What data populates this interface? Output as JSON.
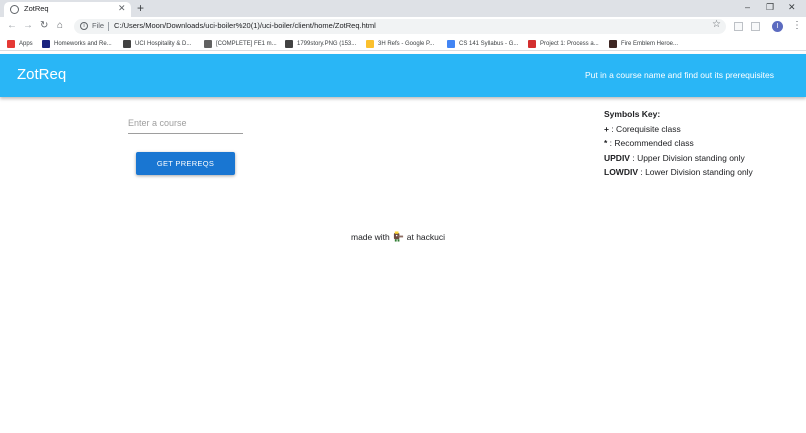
{
  "browser": {
    "tab_title": "ZotReq",
    "new_tab_symbol": "+",
    "file_label": "File",
    "url": "C:/Users/Moon/Downloads/uci-boiler%20(1)/uci-boiler/client/home/ZotReq.html",
    "profile_initial": "I"
  },
  "bookmarks": [
    {
      "label": "Apps",
      "icon_color": "#e53935"
    },
    {
      "label": "Homeworks and Re...",
      "icon_color": "#1a237e"
    },
    {
      "label": "UCI Hospitality & D...",
      "icon_color": "#424242"
    },
    {
      "label": "[COMPLETE] FE1 m...",
      "icon_color": "#616161"
    },
    {
      "label": "1799story.PNG (153...",
      "icon_color": "#424242"
    },
    {
      "label": "3H Refs - Google P...",
      "icon_color": "#fbc02d"
    },
    {
      "label": "CS 141 Syllabus - G...",
      "icon_color": "#4285f4"
    },
    {
      "label": "Project 1: Process a...",
      "icon_color": "#d32f2f"
    },
    {
      "label": "Fire Emblem Heroe...",
      "icon_color": "#3e2723"
    }
  ],
  "header": {
    "title": "ZotReq",
    "tagline": "Put in a course name and find out its prerequisites",
    "color": "#29b6f6"
  },
  "form": {
    "placeholder": "Enter a course",
    "value": "",
    "button_label": "GET PREREQS",
    "button_color": "#1976d2"
  },
  "symbols_key": {
    "title": "Symbols Key:",
    "items": [
      {
        "symbol": "+",
        "desc": " : Corequisite class"
      },
      {
        "symbol": "*",
        "desc": " : Recommended class"
      },
      {
        "symbol": "UPDIV",
        "desc": " : Upper Division standing only"
      },
      {
        "symbol": "LOWDIV",
        "desc": " : Lower Division standing only"
      }
    ]
  },
  "footer": {
    "prefix": "made with",
    "icon": "anteater-icon",
    "suffix": "at hackuci"
  }
}
